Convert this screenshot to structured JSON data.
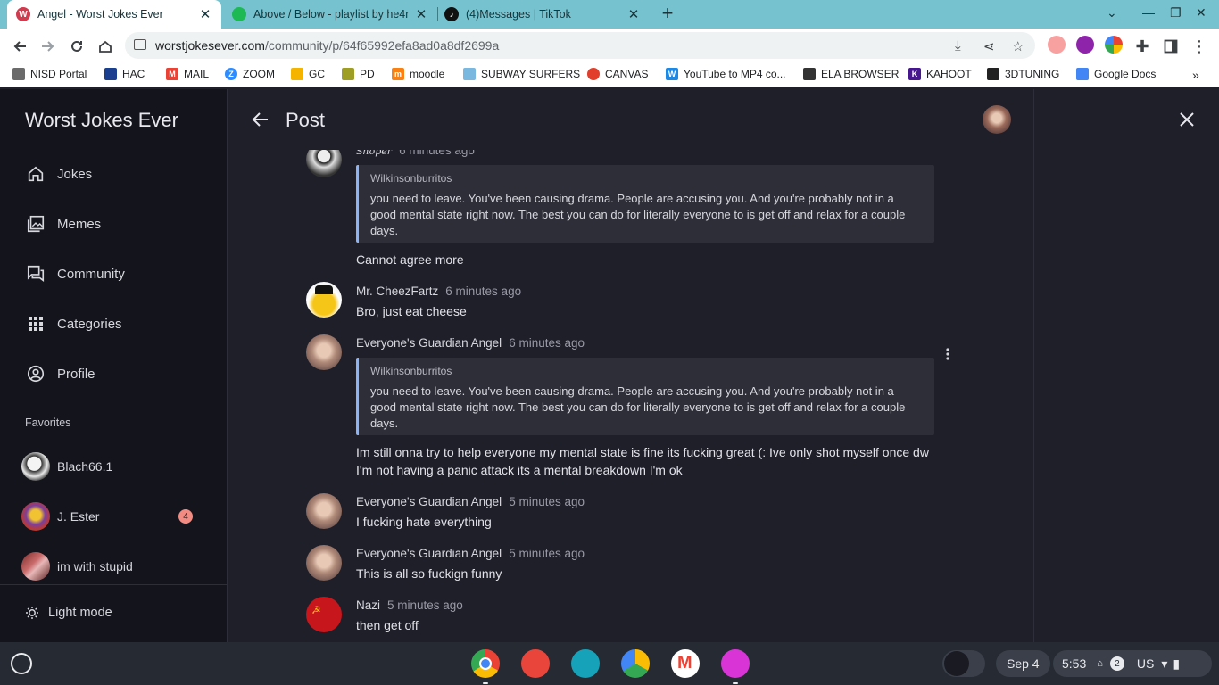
{
  "browser": {
    "tabs": [
      {
        "title": "Angel - Worst Jokes Ever",
        "favicon": "W"
      },
      {
        "title": "Above / Below - playlist by he4rt",
        "favicon": "spotify"
      },
      {
        "title": "(4)Messages | TikTok",
        "favicon": "tiktok"
      }
    ],
    "url_host": "worstjokesever.com",
    "url_path": "/community/p/64f65992efa8ad0a8df2699a",
    "bookmarks": [
      {
        "label": "NISD Portal",
        "color": "#6b6b6b"
      },
      {
        "label": "HAC",
        "color": "#1a3f8f"
      },
      {
        "label": "MAIL",
        "color": "#ea4335"
      },
      {
        "label": "ZOOM",
        "color": "#2d8cff"
      },
      {
        "label": "GC",
        "color": "#f4b400"
      },
      {
        "label": "PD",
        "color": "#9e9d24"
      },
      {
        "label": "moodle",
        "color": "#f98012"
      },
      {
        "label": "SUBWAY SURFERS",
        "color": "#7ab8e0"
      },
      {
        "label": "CANVAS",
        "color": "#e13f2b"
      },
      {
        "label": "YouTube to MP4 co...",
        "color": "#1e88e5"
      },
      {
        "label": "ELA BROWSER",
        "color": "#333333"
      },
      {
        "label": "KAHOOT",
        "color": "#46178f"
      },
      {
        "label": "3DTUNING",
        "color": "#222222"
      },
      {
        "label": "Google Docs",
        "color": "#4285f4"
      }
    ]
  },
  "sidebar": {
    "app_title": "Worst Jokes Ever",
    "nav": [
      {
        "label": "Jokes",
        "icon": "home-icon"
      },
      {
        "label": "Memes",
        "icon": "image-gallery-icon"
      },
      {
        "label": "Community",
        "icon": "forum-icon"
      },
      {
        "label": "Categories",
        "icon": "grid-icon"
      },
      {
        "label": "Profile",
        "icon": "account-circle-icon"
      }
    ],
    "favorites_heading": "Favorites",
    "favorites": [
      {
        "name": "Blach66.1",
        "badge": ""
      },
      {
        "name": "J. Ester",
        "badge": "4"
      },
      {
        "name": "im with stupid",
        "badge": ""
      }
    ],
    "light_mode_label": "Light mode"
  },
  "post": {
    "header_title": "Post",
    "comments": [
      {
        "author": "Shoper",
        "time": "6 minutes ago",
        "quote_author": "Wilkinsonburritos",
        "quote": "you need to leave. You've been causing drama. People are accusing you. And you're probably not in a good mental state right now. The best you can do for literally everyone to is get off and relax for a couple days.",
        "text": "Cannot agree more"
      },
      {
        "author": "Mr. CheezFartz",
        "time": "6 minutes ago",
        "text": "Bro, just eat cheese"
      },
      {
        "author": "Everyone's Guardian Angel",
        "time": "6 minutes ago",
        "quote_author": "Wilkinsonburritos",
        "quote": "you need to leave. You've been causing drama. People are accusing you. And you're probably not in a good mental state right now. The best you can do for literally everyone to is get off and relax for a couple days.",
        "text": "Im still onna try to help everyone my mental state is fine its fucking great (: Ive only shot myself once dw I'm not having a panic attack its a mental breakdown I'm ok"
      },
      {
        "author": "Everyone's Guardian Angel",
        "time": "5 minutes ago",
        "text": "I fucking hate everything"
      },
      {
        "author": "Everyone's Guardian Angel",
        "time": "5 minutes ago",
        "text": "This is all so fuckign funny"
      },
      {
        "author": "Nazi",
        "time": "5 minutes ago",
        "text": "then get off"
      }
    ]
  },
  "shelf": {
    "date": "Sep 4",
    "time": "5:53",
    "notification_count": "2",
    "input_method": "US"
  }
}
